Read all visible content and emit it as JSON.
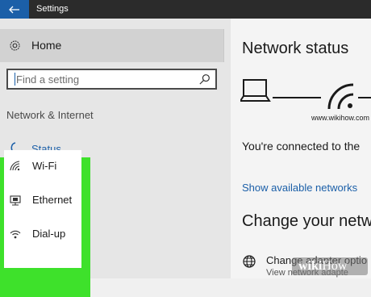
{
  "window": {
    "title": "Settings"
  },
  "sidebar": {
    "home_label": "Home",
    "search_placeholder": "Find a setting",
    "section_title": "Network & Internet",
    "status_label": "Status",
    "items": [
      {
        "label": "Wi-Fi",
        "icon": "wifi-icon"
      },
      {
        "label": "Ethernet",
        "icon": "ethernet-icon"
      },
      {
        "label": "Dial-up",
        "icon": "dialup-icon"
      }
    ]
  },
  "main": {
    "title": "Network status",
    "diagram_caption": "www.wikihow.com",
    "connected_text": "You're connected to the",
    "show_networks_link": "Show available networks",
    "change_title": "Change your netw",
    "adapter_title": "Change adapter optio",
    "adapter_sub": "View network adapte"
  },
  "watermark": {
    "text_bold": "wiki",
    "text_rest": "How"
  },
  "colors": {
    "accent": "#1b5fa8",
    "highlight": "#3ee12b",
    "titlebar": "#2b2b2b"
  }
}
